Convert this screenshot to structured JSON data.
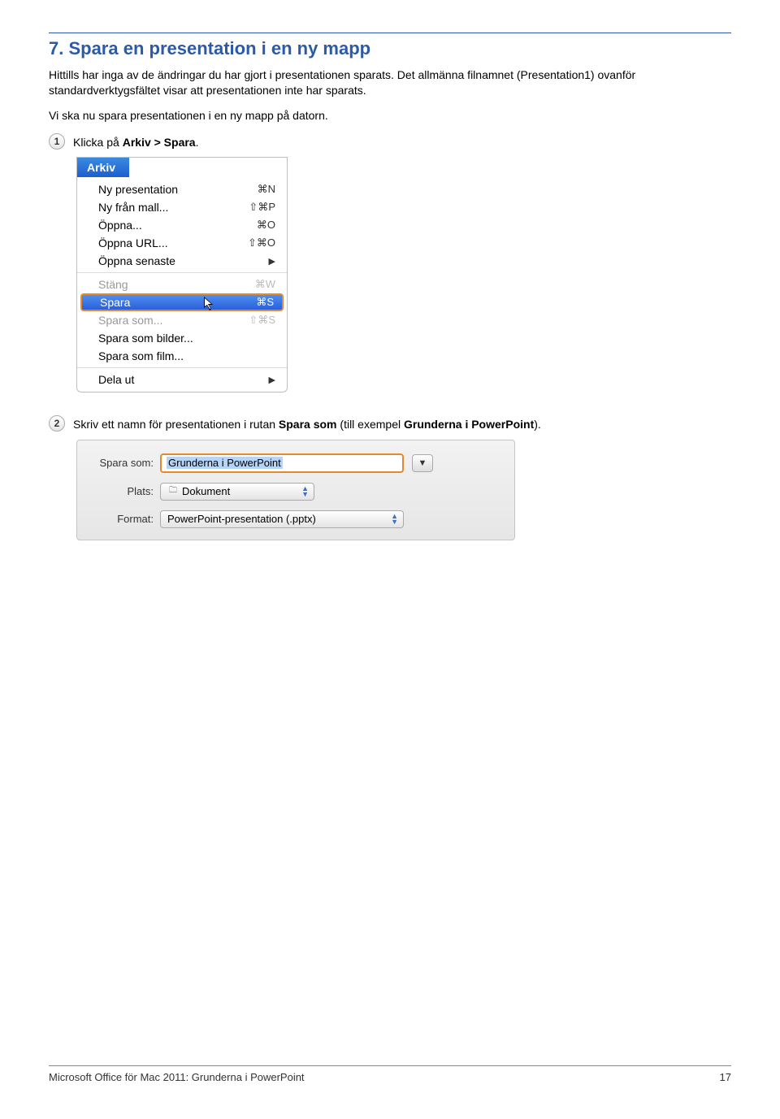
{
  "heading": "7. Spara en presentation i en ny mapp",
  "para1": "Hittills har inga av de ändringar du har gjort i presentationen sparats. Det allmänna filnamnet (Presentation1) ovanför standardverktygsfältet visar att presentationen inte har sparats.",
  "para2": "Vi ska nu spara presentationen i en ny mapp på datorn.",
  "step1_num": "1",
  "step1_pre": "Klicka på ",
  "step1_bold": "Arkiv > Spara",
  "step1_post": ".",
  "arkiv_title": "Arkiv",
  "menu": {
    "new_presentation": "Ny presentation",
    "new_presentation_sc": "⌘N",
    "new_template": "Ny från mall...",
    "new_template_sc": "⇧⌘P",
    "open": "Öppna...",
    "open_sc": "⌘O",
    "open_url": "Öppna URL...",
    "open_url_sc": "⇧⌘O",
    "open_recent": "Öppna senaste",
    "close": "Stäng",
    "close_sc": "⌘W",
    "save": "Spara",
    "save_sc": "⌘S",
    "save_as": "Spara som...",
    "save_as_sc": "⇧⌘S",
    "save_pics": "Spara som bilder...",
    "save_movie": "Spara som film...",
    "share": "Dela ut"
  },
  "step2_num": "2",
  "step2_pre": "Skriv ett namn för presentationen i rutan ",
  "step2_b1": "Spara som",
  "step2_mid": " (till exempel ",
  "step2_b2": "Grunderna i PowerPoint",
  "step2_post": ").",
  "dialog": {
    "spara_som_label": "Spara som:",
    "filename": "Grunderna i PowerPoint",
    "plats_label": "Plats:",
    "plats_value": "Dokument",
    "format_label": "Format:",
    "format_value": "PowerPoint-presentation (.pptx)"
  },
  "footer_left": "Microsoft Office för Mac 2011: Grunderna i PowerPoint",
  "footer_right": "17"
}
